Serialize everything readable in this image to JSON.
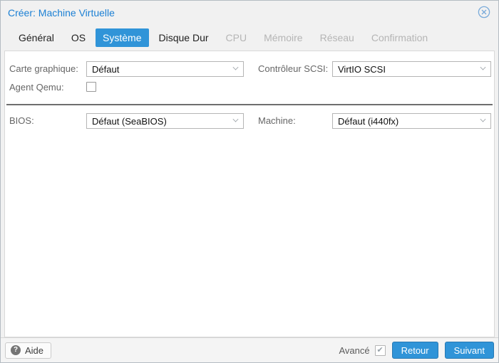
{
  "window": {
    "title": "Créer: Machine Virtuelle",
    "close_icon": "circle-x-icon"
  },
  "tabs": [
    {
      "label": "Général",
      "state": "enabled"
    },
    {
      "label": "OS",
      "state": "enabled"
    },
    {
      "label": "Système",
      "state": "active"
    },
    {
      "label": "Disque Dur",
      "state": "enabled"
    },
    {
      "label": "CPU",
      "state": "disabled"
    },
    {
      "label": "Mémoire",
      "state": "disabled"
    },
    {
      "label": "Réseau",
      "state": "disabled"
    },
    {
      "label": "Confirmation",
      "state": "disabled"
    }
  ],
  "form": {
    "graphics_card": {
      "label": "Carte graphique:",
      "value": "Défaut",
      "type": "select"
    },
    "scsi_controller": {
      "label": "Contrôleur SCSI:",
      "value": "VirtIO SCSI",
      "type": "select"
    },
    "qemu_agent": {
      "label": "Agent Qemu:",
      "checked": false,
      "type": "checkbox"
    },
    "bios": {
      "label": "BIOS:",
      "value": "Défaut (SeaBIOS)",
      "type": "select"
    },
    "machine": {
      "label": "Machine:",
      "value": "Défaut (i440fx)",
      "type": "select"
    }
  },
  "footer": {
    "help_label": "Aide",
    "help_icon": "question-mark-icon",
    "advanced_label": "Avancé",
    "advanced_checked": true,
    "back_label": "Retour",
    "next_label": "Suivant"
  },
  "colors": {
    "accent_blue": "#3094d8",
    "title_blue": "#1c80d4",
    "close_icon_blue": "#7aabda",
    "header_bg": "#f1f1f1",
    "panel_bg": "#ffffff",
    "panel_border": "#d9d9d9",
    "label_grey": "#666666",
    "field_border": "#b5b5b5",
    "separator_grey": "#6e6e6e",
    "disabled_tab_grey": "#b5b5b5"
  }
}
